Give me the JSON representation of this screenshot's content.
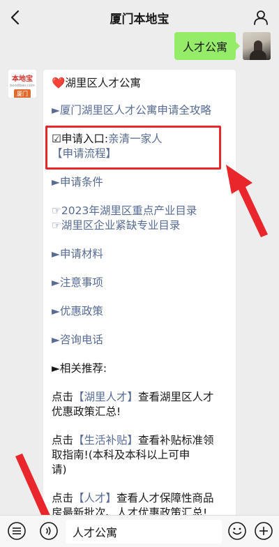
{
  "header": {
    "title": "厦门本地宝"
  },
  "my_message": {
    "text": "人才公寓"
  },
  "bot": {
    "avatar_logo": "本地宝",
    "avatar_sub": "bendibao.com",
    "avatar_city": "厦门",
    "title_heart": "❤️",
    "title": "湖里区人才公寓",
    "link_guide": "►厦门湖里区人才公寓申请全攻略",
    "apply_prefix": "☑申请入口:",
    "apply_link": "亲清一家人",
    "process_link": "【申请流程】",
    "conditions": "►申请条件",
    "catalog_2023": "☞2023年湖里区重点产业目录",
    "catalog_shortage": "☞湖里区企业紧缺专业目录",
    "materials": "►申请材料",
    "notes": "►注意事项",
    "policy": "►优惠政策",
    "phone": "►咨询电话",
    "related": "►相关推荐:",
    "p1_a": "点击",
    "p1_link": "【湖里人才】",
    "p1_b": "查看湖里区人才",
    "p1_c": "优惠政策汇总!",
    "p2_a": "点击",
    "p2_link": "【生活补贴】",
    "p2_b": "查看补贴标准领",
    "p2_c": "取指南!(本科及本科以上可申",
    "p2_d": "请)",
    "p3_a": "点击",
    "p3_link": "【人才】",
    "p3_b": "查看人才保障性商品",
    "p3_c": "房最新批次、人才优惠政策汇总!"
  },
  "input": {
    "value": "人才公寓"
  },
  "colors": {
    "bubble_green": "#95ec69",
    "link": "#576b95",
    "annotation_red": "#e8262b"
  }
}
